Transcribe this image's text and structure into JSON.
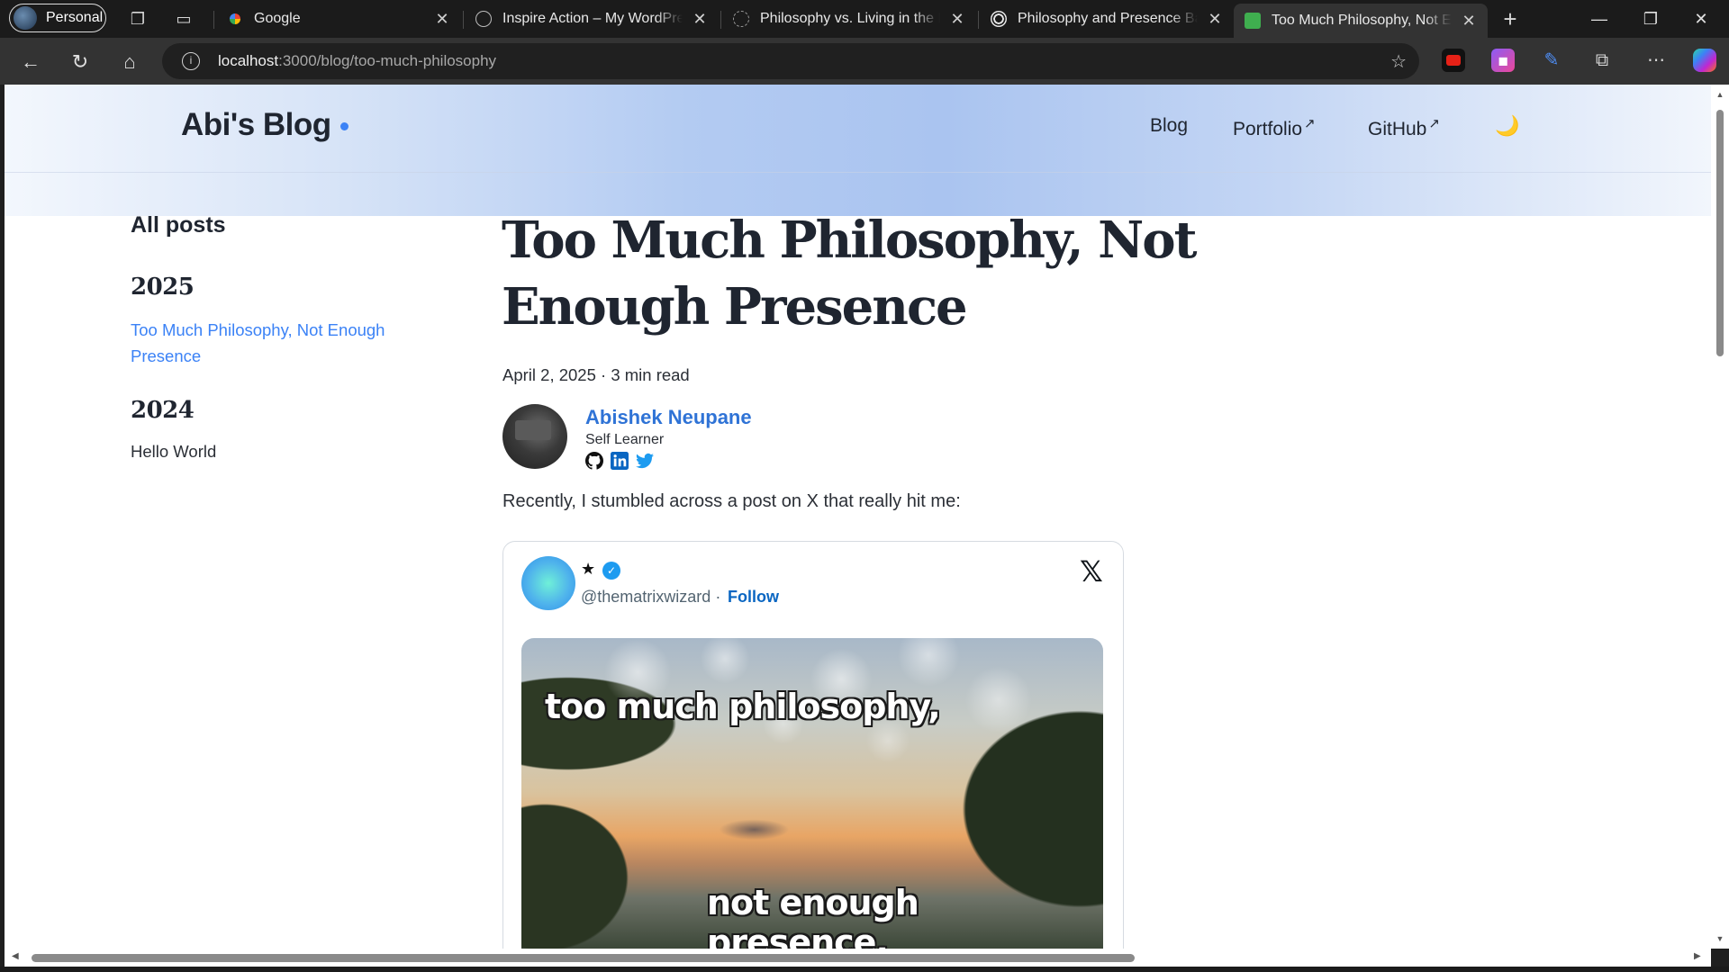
{
  "browser": {
    "profile_label": "Personal",
    "tabs": [
      {
        "title": "Google"
      },
      {
        "title": "Inspire Action – My WordPress"
      },
      {
        "title": "Philosophy vs. Living in the Mo"
      },
      {
        "title": "Philosophy and Presence Balan"
      },
      {
        "title": "Too Much Philosophy, Not Eno"
      }
    ],
    "new_tab_symbol": "+",
    "url_host": "localhost",
    "url_path": ":3000/blog/too-much-philosophy"
  },
  "site": {
    "logo": "Abi's Blog",
    "nav": [
      {
        "label": "Blog",
        "arrow": ""
      },
      {
        "label": "Portfolio",
        "arrow": "↗"
      },
      {
        "label": "GitHub",
        "arrow": "↗"
      }
    ]
  },
  "sidebar": {
    "title": "All posts",
    "groups": [
      {
        "year": "2025",
        "posts": [
          "Too Much Philosophy, Not Enough Presence"
        ]
      },
      {
        "year": "2024",
        "posts": [
          "Hello World"
        ]
      }
    ]
  },
  "post": {
    "title": "Too Much Philosophy, Not Enough Presence",
    "meta": "April 2, 2025 · 3 min read",
    "author": {
      "name": "Abishek Neupane",
      "role": "Self Learner"
    },
    "intro": "Recently, I stumbled across a post on X that really hit me:"
  },
  "tweet": {
    "display_name": "★",
    "handle": "@thematrixwizard",
    "separator": "·",
    "follow_label": "Follow",
    "caption_top": "too much philosophy,",
    "caption_bottom": "not enough presence."
  },
  "colors": {
    "accent_blue": "#2f73d6",
    "link_blue": "#3b82f6",
    "follow_blue": "#0a66c2"
  }
}
